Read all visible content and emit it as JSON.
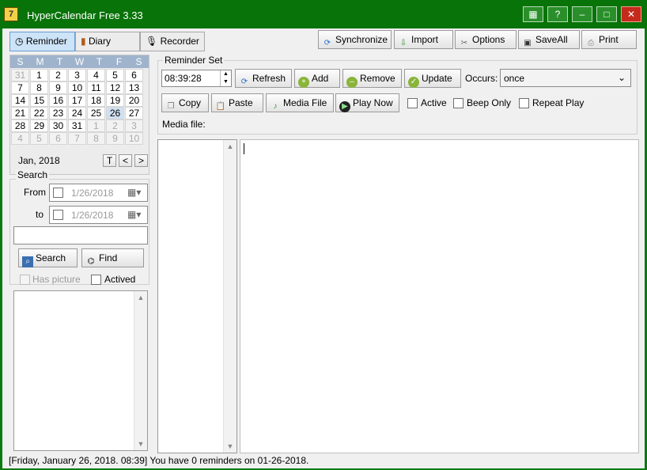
{
  "window": {
    "title": "HyperCalendar Free 3.33",
    "icon_label": "7"
  },
  "tabs": [
    {
      "label": "Reminder"
    },
    {
      "label": "Diary"
    },
    {
      "label": "Recorder"
    }
  ],
  "toolbar": {
    "synchronize": "Synchronize",
    "import": "Import",
    "options": "Options",
    "saveall": "SaveAll",
    "print": "Print"
  },
  "calendar": {
    "weekdays": [
      "S",
      "M",
      "T",
      "W",
      "T",
      "F",
      "S"
    ],
    "month_label": "Jan, 2018",
    "today_btn": "T",
    "prev_btn": "<",
    "next_btn": ">",
    "days": [
      [
        "31",
        "1",
        "2",
        "3",
        "4",
        "5",
        "6"
      ],
      [
        "7",
        "8",
        "9",
        "10",
        "11",
        "12",
        "13"
      ],
      [
        "14",
        "15",
        "16",
        "17",
        "18",
        "19",
        "20"
      ],
      [
        "21",
        "22",
        "23",
        "24",
        "25",
        "26",
        "27"
      ],
      [
        "28",
        "29",
        "30",
        "31",
        "1",
        "2",
        "3"
      ],
      [
        "4",
        "5",
        "6",
        "7",
        "8",
        "9",
        "10"
      ]
    ]
  },
  "search": {
    "group_label": "Search",
    "from_label": "From",
    "to_label": "to",
    "from_date": "1/26/2018",
    "to_date": "1/26/2018",
    "text_value": "",
    "search_btn": "Search",
    "find_btn": "Find",
    "has_picture": "Has picture",
    "actived": "Actived"
  },
  "reminder_set": {
    "group_label": "Reminder Set",
    "time": "08:39:28",
    "refresh": "Refresh",
    "add": "Add",
    "remove": "Remove",
    "update": "Update",
    "occurs_label": "Occurs:",
    "occurs_value": "once",
    "copy": "Copy",
    "paste": "Paste",
    "media_file_btn": "Media File",
    "play_now": "Play Now",
    "active": "Active",
    "beep_only": "Beep Only",
    "repeat_play": "Repeat Play",
    "media_file_label": "Media file:"
  },
  "status": {
    "text": "[Friday, January 26, 2018. 08:39] You have 0 reminders on 01-26-2018."
  }
}
